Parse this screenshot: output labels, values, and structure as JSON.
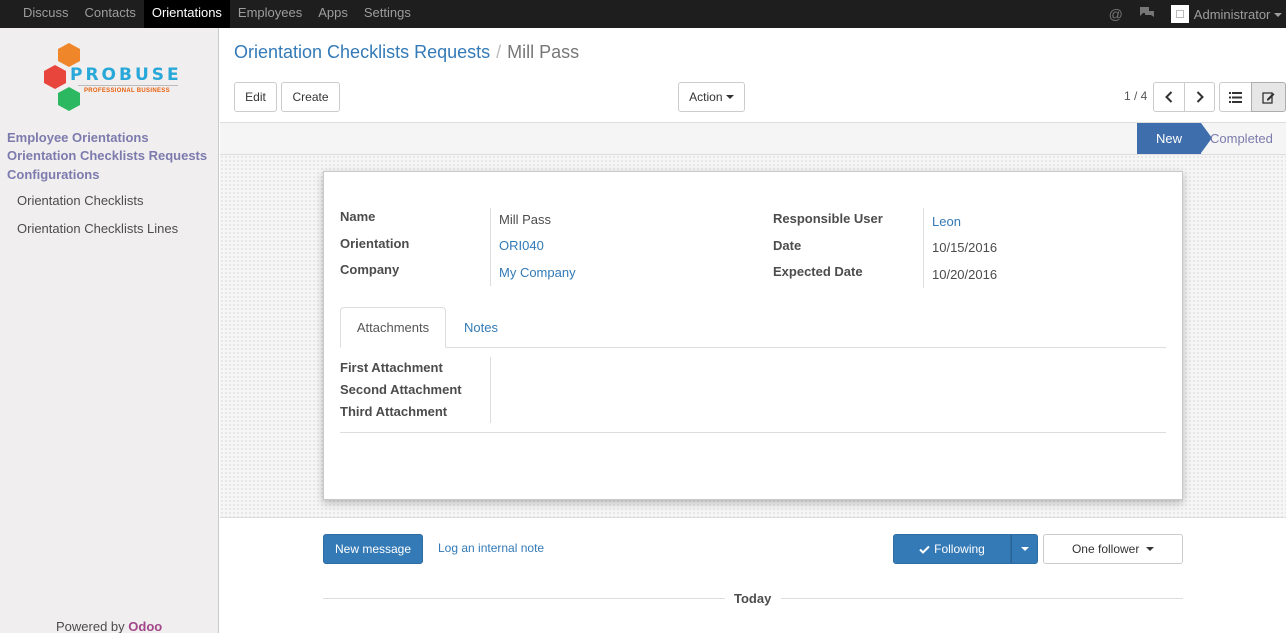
{
  "topbar": {
    "menu": [
      "Discuss",
      "Contacts",
      "Orientations",
      "Employees",
      "Apps",
      "Settings"
    ],
    "active": "Orientations",
    "user": "Administrator"
  },
  "sidebar": {
    "logo": {
      "brand": "PROBUSE",
      "tagline": "PROFESSIONAL BUSINESS"
    },
    "headers": [
      "Employee Orientations",
      "Orientation Checklists Requests",
      "Configurations"
    ],
    "items": [
      "Orientation Checklists",
      "Orientation Checklists Lines"
    ],
    "powered_prefix": "Powered by",
    "powered_brand": "Odoo"
  },
  "control": {
    "breadcrumb_parent": "Orientation Checklists Requests",
    "breadcrumb_sep": "/",
    "breadcrumb_current": "Mill Pass",
    "edit": "Edit",
    "create": "Create",
    "action": "Action",
    "pager": "1 / 4"
  },
  "status": {
    "new": "New",
    "completed": "Completed"
  },
  "form": {
    "name_label": "Name",
    "name_value": "Mill Pass",
    "orientation_label": "Orientation",
    "orientation_value": "ORI040",
    "company_label": "Company",
    "company_value": "My Company",
    "responsible_label": "Responsible User",
    "responsible_value": "Leon",
    "date_label": "Date",
    "date_value": "10/15/2016",
    "expected_label": "Expected Date",
    "expected_value": "10/20/2016",
    "tabs": [
      "Attachments",
      "Notes"
    ],
    "attachments": [
      "First Attachment",
      "Second Attachment",
      "Third Attachment"
    ]
  },
  "chatter": {
    "new_message": "New message",
    "log_note": "Log an internal note",
    "following": "Following",
    "followers": "One follower",
    "today": "Today"
  },
  "colors": {
    "primary": "#337ab7",
    "status_active": "#3e6eab",
    "menu_header": "#7c7bad",
    "odoo": "#a24689"
  }
}
